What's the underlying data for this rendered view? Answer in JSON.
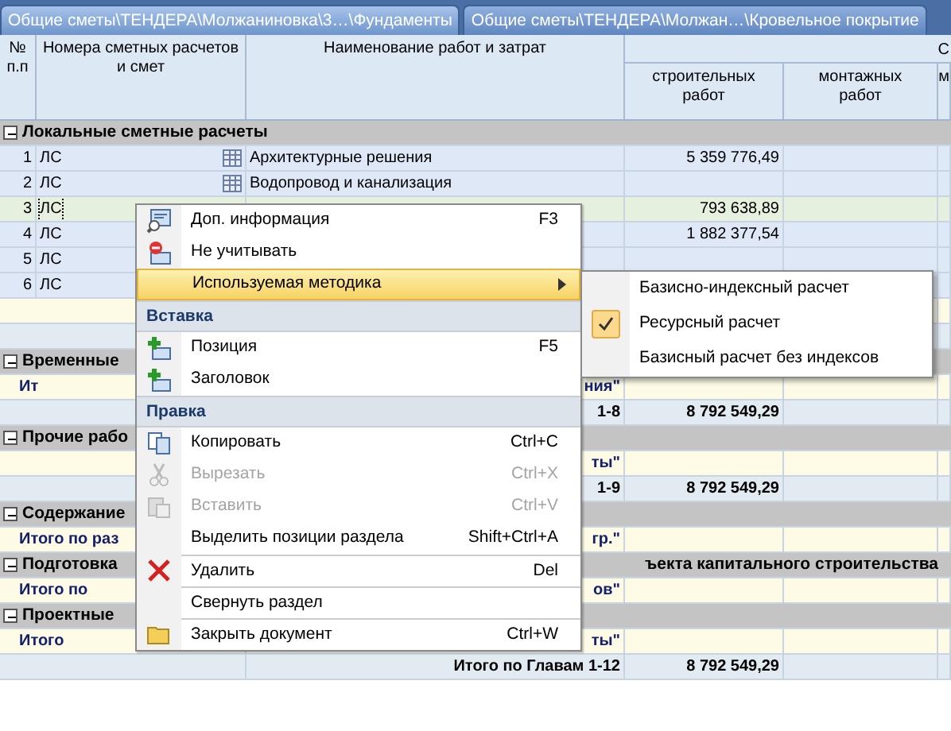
{
  "tabs": [
    {
      "label": "Общие сметы\\ТЕНДЕРА\\Молжаниновка\\3…\\Фундаменты",
      "selected": true
    },
    {
      "label": "Общие сметы\\ТЕНДЕРА\\Молжан…\\Кровельное покрытие",
      "selected": false
    }
  ],
  "table": {
    "columns": [
      "№ п.п",
      "Номера сметных расчетов и смет",
      "Наименование работ и затрат"
    ],
    "group_header": "С",
    "subcolumns": [
      "строительных работ",
      "монтажных работ",
      "м"
    ],
    "rows": [
      {
        "kind": "group",
        "text": "Локальные сметные расчеты"
      },
      {
        "kind": "item",
        "num": "1",
        "code": "ЛС",
        "name": "Архитектурные решения",
        "value": "5 359 776,49",
        "selected": false
      },
      {
        "kind": "item",
        "num": "2",
        "code": "ЛС",
        "name": "Водопровод и канализация",
        "selected": false
      },
      {
        "kind": "item",
        "num": "3",
        "code": "ЛС",
        "value": "793 638,89",
        "selected": true
      },
      {
        "kind": "item",
        "num": "4",
        "code": "ЛС",
        "value": "1 882 377,54",
        "selected": false
      },
      {
        "kind": "item",
        "num": "5",
        "code": "ЛС",
        "selected": false
      },
      {
        "kind": "item",
        "num": "6",
        "code": "ЛС",
        "selected": false
      },
      {
        "kind": "total"
      },
      {
        "kind": "subtotal"
      },
      {
        "kind": "group",
        "text": "Временные"
      },
      {
        "kind": "total",
        "left": "Ит",
        "right": "ния\""
      },
      {
        "kind": "subtotal",
        "label": "1-8",
        "value": "8 792 549,29"
      },
      {
        "kind": "group",
        "text": "Прочие рабо"
      },
      {
        "kind": "total",
        "right": "ты\""
      },
      {
        "kind": "subtotal",
        "label": "1-9",
        "value": "8 792 549,29"
      },
      {
        "kind": "group",
        "text": "Содержание"
      },
      {
        "kind": "total",
        "left": "Итого по раз",
        "right": "гр.\""
      },
      {
        "kind": "group",
        "text": "Подготовка",
        "continuation": "ъекта капитального строительства"
      },
      {
        "kind": "total",
        "left": "Итого по",
        "right": "ов\""
      },
      {
        "kind": "group",
        "text": "Проектные"
      },
      {
        "kind": "total",
        "left": "Итого",
        "right": "ты\""
      },
      {
        "kind": "subtotal",
        "label": "Итого по Главам 1-12",
        "value": "8 792 549,29"
      }
    ]
  },
  "context_menu": {
    "items": [
      {
        "kind": "item",
        "label": "Доп. информация",
        "shortcut": "F3",
        "disabled": false,
        "selected": false
      },
      {
        "kind": "item",
        "label": "Не учитывать",
        "disabled": false,
        "selected": false
      },
      {
        "kind": "item",
        "label": "Используемая методика",
        "disabled": false,
        "selected": true,
        "submenu": true
      },
      {
        "kind": "header",
        "label": "Вставка"
      },
      {
        "kind": "item",
        "label": "Позиция",
        "shortcut": "F5",
        "disabled": false,
        "selected": false
      },
      {
        "kind": "item",
        "label": "Заголовок",
        "disabled": false,
        "selected": false
      },
      {
        "kind": "header",
        "label": "Правка"
      },
      {
        "kind": "item",
        "label": "Копировать",
        "shortcut": "Ctrl+C",
        "disabled": false,
        "selected": false
      },
      {
        "kind": "item",
        "label": "Вырезать",
        "shortcut": "Ctrl+X",
        "disabled": true,
        "selected": false
      },
      {
        "kind": "item",
        "label": "Вставить",
        "shortcut": "Ctrl+V",
        "disabled": true,
        "selected": false
      },
      {
        "kind": "item",
        "label": "Выделить позиции раздела",
        "shortcut": "Shift+Ctrl+A",
        "disabled": false,
        "selected": false
      },
      {
        "kind": "item",
        "label": "Удалить",
        "shortcut": "Del",
        "disabled": false,
        "selected": false,
        "separator": true
      },
      {
        "kind": "item",
        "label": "Свернуть раздел",
        "disabled": false,
        "selected": false,
        "separator": true
      },
      {
        "kind": "item",
        "label": "Закрыть документ",
        "shortcut": "Ctrl+W",
        "disabled": false,
        "selected": false,
        "separator": true
      }
    ]
  },
  "submenu": {
    "items": [
      {
        "label": "Базисно-индексный расчет",
        "checked": false
      },
      {
        "label": "Ресурсный расчет",
        "checked": true
      },
      {
        "label": "Базисный расчет без индексов",
        "checked": false
      }
    ]
  }
}
